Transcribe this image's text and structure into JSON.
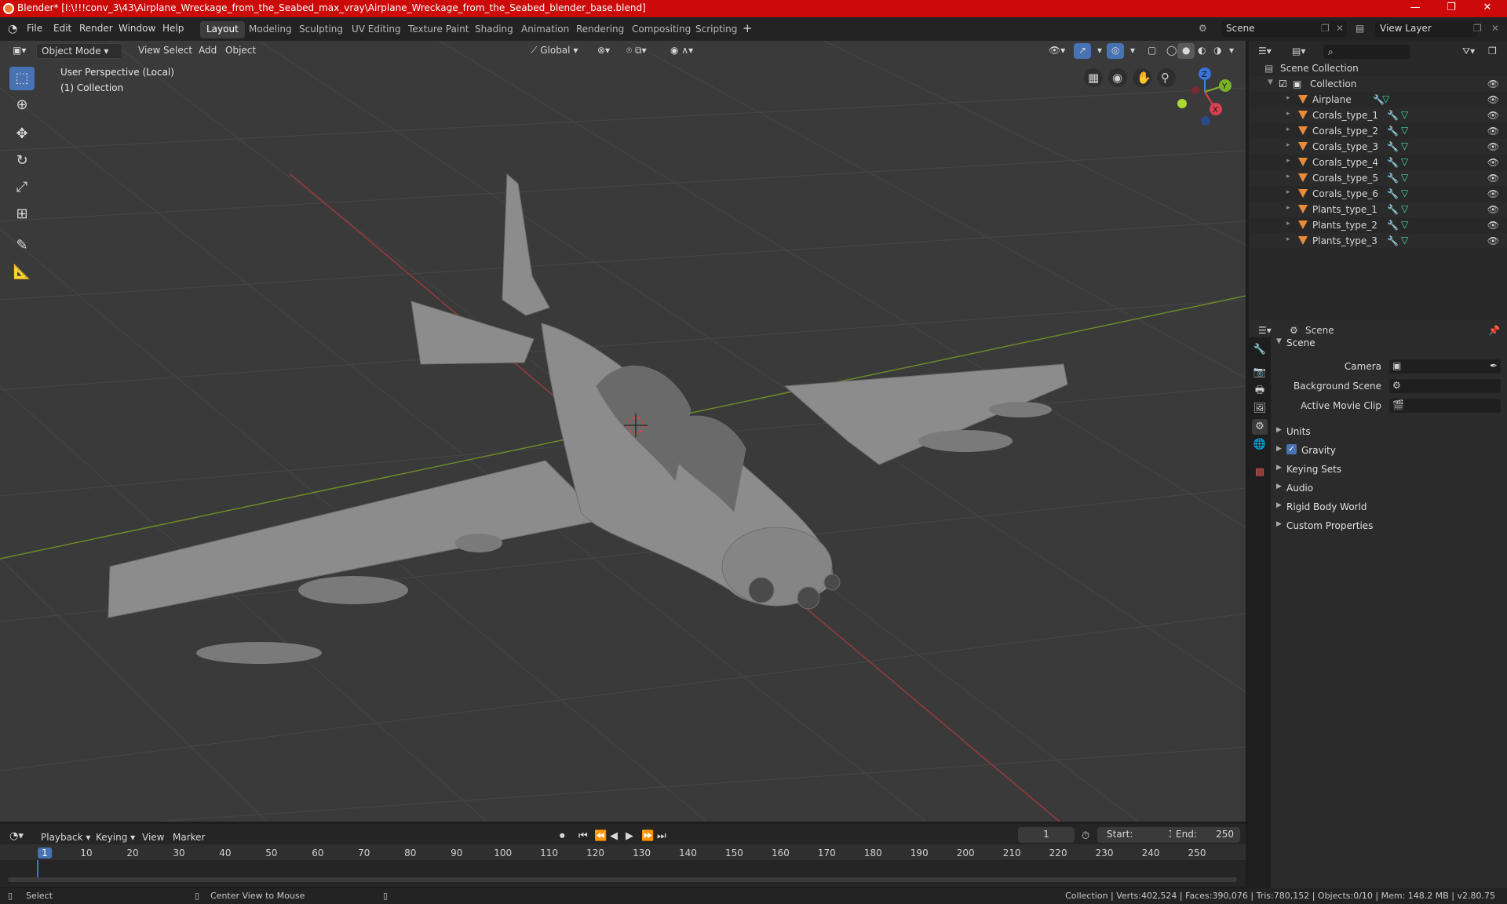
{
  "window": {
    "title": "Blender* [I:\\!!!conv_3\\43\\Airplane_Wreckage_from_the_Seabed_max_vray\\Airplane_Wreckage_from_the_Seabed_blender_base.blend]",
    "minimize": "—",
    "maximize": "❐",
    "close": "✕"
  },
  "menu": [
    "File",
    "Edit",
    "Render",
    "Window",
    "Help"
  ],
  "workspaces": [
    "Layout",
    "Modeling",
    "Sculpting",
    "UV Editing",
    "Texture Paint",
    "Shading",
    "Animation",
    "Rendering",
    "Compositing",
    "Scripting"
  ],
  "active_workspace": "Layout",
  "scene_selector": "Scene",
  "view_layer": "View Layer",
  "viewport": {
    "mode": "Object Mode",
    "menus": [
      "View",
      "Select",
      "Add",
      "Object"
    ],
    "orientation": "Global",
    "perspective_label": "User Perspective (Local)",
    "collection_label": "(1) Collection",
    "gizmo": {
      "x": "X",
      "y": "Y",
      "z": "Z"
    }
  },
  "outliner": {
    "root": "Scene Collection",
    "collection": "Collection",
    "objects": [
      "Airplane",
      "Corals_type_1",
      "Corals_type_2",
      "Corals_type_3",
      "Corals_type_4",
      "Corals_type_5",
      "Corals_type_6",
      "Plants_type_1",
      "Plants_type_2",
      "Plants_type_3"
    ]
  },
  "properties": {
    "context": "Scene",
    "panel": "Scene",
    "camera_label": "Camera",
    "background_label": "Background Scene",
    "movie_clip_label": "Active Movie Clip",
    "sections": [
      "Units",
      "Gravity",
      "Keying Sets",
      "Audio",
      "Rigid Body World",
      "Custom Properties"
    ],
    "gravity_checked": true
  },
  "timeline": {
    "menus": [
      "Playback",
      "Keying",
      "View",
      "Marker"
    ],
    "current_frame": "1",
    "start_label": "Start:",
    "start": "1",
    "end_label": "End:",
    "end": "250",
    "ticks": [
      "1",
      "10",
      "20",
      "30",
      "40",
      "50",
      "60",
      "70",
      "80",
      "90",
      "100",
      "110",
      "120",
      "130",
      "140",
      "150",
      "160",
      "170",
      "180",
      "190",
      "200",
      "210",
      "220",
      "230",
      "240",
      "250"
    ]
  },
  "status": {
    "left_action": "Select",
    "mid_action": "Center View to Mouse",
    "stats": "Collection | Verts:402,524 | Faces:390,076 | Tris:780,152 | Objects:0/10 | Mem: 148.2 MB | v2.80.75"
  }
}
